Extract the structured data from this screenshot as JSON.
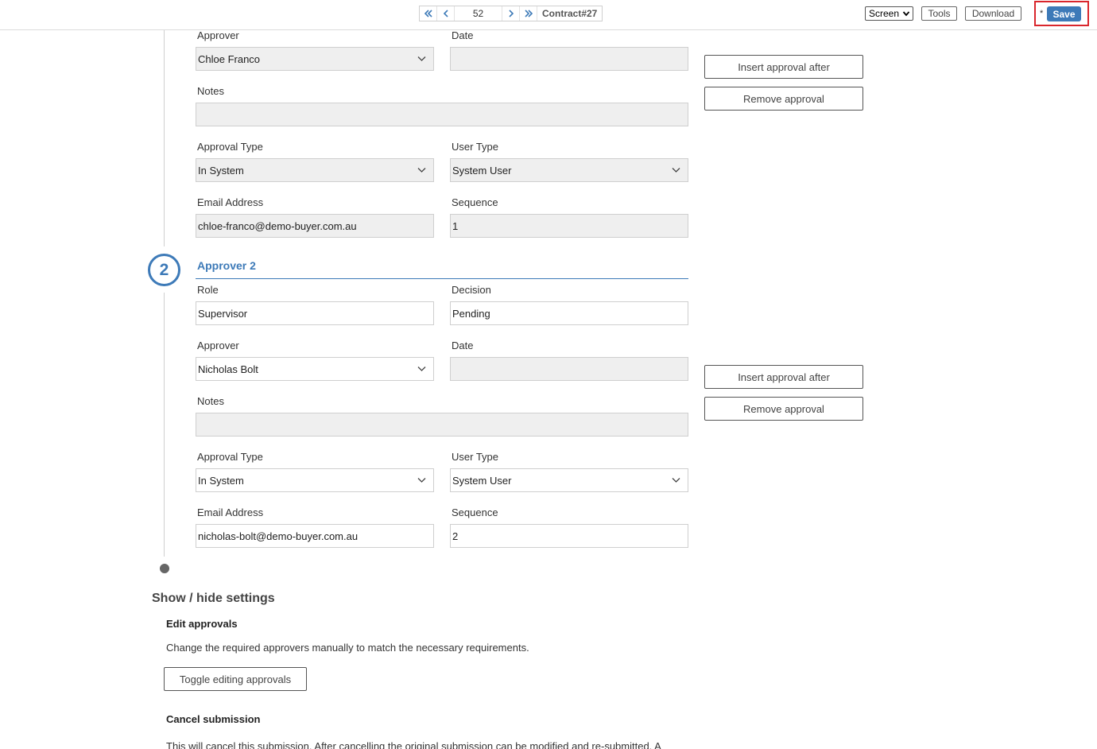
{
  "toolbar": {
    "page_number": "52",
    "document_title": "Contract#27",
    "view_select": "Screen",
    "tools_label": "Tools",
    "download_label": "Download",
    "unsaved_marker": "*",
    "save_label": "Save",
    "icons": [
      "first-page-icon",
      "prev-page-icon",
      "next-page-icon",
      "last-page-icon"
    ],
    "accent_color": "#3d7ab8",
    "highlight_color": "#d9262c"
  },
  "approver1": {
    "approver_label": "Approver",
    "approver_value": "Chloe Franco",
    "date_label": "Date",
    "date_value": "",
    "notes_label": "Notes",
    "notes_value": "",
    "approval_type_label": "Approval Type",
    "approval_type_value": "In System",
    "user_type_label": "User Type",
    "user_type_value": "System User",
    "email_label": "Email Address",
    "email_value": "chloe-franco@demo-buyer.com.au",
    "sequence_label": "Sequence",
    "sequence_value": "1",
    "insert_label": "Insert approval after",
    "remove_label": "Remove approval"
  },
  "approver2": {
    "step_number": "2",
    "title": "Approver 2",
    "role_label": "Role",
    "role_value": "Supervisor",
    "decision_label": "Decision",
    "decision_value": "Pending",
    "approver_label": "Approver",
    "approver_value": "Nicholas Bolt",
    "date_label": "Date",
    "date_value": "",
    "notes_label": "Notes",
    "notes_value": "",
    "approval_type_label": "Approval Type",
    "approval_type_value": "In System",
    "user_type_label": "User Type",
    "user_type_value": "System User",
    "email_label": "Email Address",
    "email_value": "nicholas-bolt@demo-buyer.com.au",
    "sequence_label": "Sequence",
    "sequence_value": "2",
    "insert_label": "Insert approval after",
    "remove_label": "Remove approval"
  },
  "settings": {
    "heading": "Show / hide settings",
    "edit_title": "Edit approvals",
    "edit_text": "Change the required approvers manually to match the necessary requirements.",
    "toggle_label": "Toggle editing approvals",
    "cancel_title": "Cancel submission",
    "cancel_text": "This will cancel this submission. After cancelling the original submission can be modified and re-submitted. A"
  }
}
